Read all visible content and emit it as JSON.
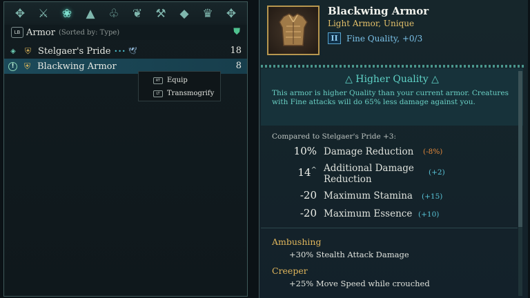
{
  "inventory": {
    "category_icons": [
      {
        "name": "consumables-icon",
        "glyph": "✥"
      },
      {
        "name": "weapons-icon",
        "glyph": "⚔"
      },
      {
        "name": "armor-icon",
        "glyph": "❀"
      },
      {
        "name": "boots-icon",
        "glyph": "▲"
      },
      {
        "name": "rings-icon",
        "glyph": "♧"
      },
      {
        "name": "quickslot-icon",
        "glyph": "❦"
      },
      {
        "name": "crafting-icon",
        "glyph": "⚒"
      },
      {
        "name": "gems-icon",
        "glyph": "◆"
      },
      {
        "name": "cosmetics-icon",
        "glyph": "♛"
      },
      {
        "name": "misc-icon",
        "glyph": "✥"
      }
    ],
    "active_category_index": 2,
    "tab_key": "LB",
    "section_title": "Armor",
    "sort_label": "(Sorted by: Type)",
    "items": [
      {
        "marker": "◈",
        "name": "Stelgaer's Pride",
        "rank_dots": "•••",
        "bird": "🕊",
        "level": "18"
      },
      {
        "marker": "!",
        "name": "Blackwing Armor",
        "level": "8"
      }
    ],
    "context_menu": [
      {
        "key": "RT",
        "label": "Equip"
      },
      {
        "key": "LT",
        "label": "Transmogrify"
      }
    ]
  },
  "details": {
    "title": "Blackwing Armor",
    "type": "Light Armor, Unique",
    "quality_badge": "II",
    "quality_text": "Fine Quality, +0/3",
    "notice_title": "△ Higher Quality △",
    "notice_text": "This armor is higher Quality than your current armor. Creatures with Fine attacks will do 65% less damage against you.",
    "compare_label": "Compared to Stelgaer's Pride +3:",
    "stats": [
      {
        "value": "10%",
        "caret": "",
        "label": "Damage Reduction",
        "diff": "(-8%)",
        "diff_kind": "neg"
      },
      {
        "value": "14",
        "caret": "^",
        "label": "Additional Damage Reduction",
        "diff": "(+2)",
        "diff_kind": "pos"
      },
      {
        "value": "-20",
        "caret": "",
        "label": "Maximum Stamina",
        "diff": "(+15)",
        "diff_kind": "pos"
      },
      {
        "value": "-20",
        "caret": "",
        "label": "Maximum Essence",
        "diff": "(+10)",
        "diff_kind": "pos"
      }
    ],
    "perks": [
      {
        "name": "Ambushing",
        "desc": "+30% Stealth Attack Damage"
      },
      {
        "name": "Creeper",
        "desc": "+25% Move Speed while crouched"
      }
    ]
  },
  "colors": {
    "accent_teal": "#5fd3c7",
    "gold": "#e3c06a",
    "quality_blue": "#7cc3ea",
    "negative": "#e0873a",
    "positive": "#58c3d6"
  }
}
